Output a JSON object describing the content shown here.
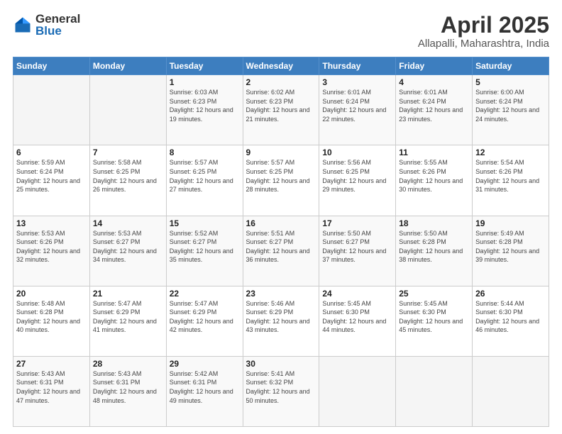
{
  "logo": {
    "general": "General",
    "blue": "Blue"
  },
  "header": {
    "title": "April 2025",
    "subtitle": "Allapalli, Maharashtra, India"
  },
  "weekdays": [
    "Sunday",
    "Monday",
    "Tuesday",
    "Wednesday",
    "Thursday",
    "Friday",
    "Saturday"
  ],
  "weeks": [
    [
      {
        "day": "",
        "sunrise": "",
        "sunset": "",
        "daylight": ""
      },
      {
        "day": "",
        "sunrise": "",
        "sunset": "",
        "daylight": ""
      },
      {
        "day": "1",
        "sunrise": "Sunrise: 6:03 AM",
        "sunset": "Sunset: 6:23 PM",
        "daylight": "Daylight: 12 hours and 19 minutes."
      },
      {
        "day": "2",
        "sunrise": "Sunrise: 6:02 AM",
        "sunset": "Sunset: 6:23 PM",
        "daylight": "Daylight: 12 hours and 21 minutes."
      },
      {
        "day": "3",
        "sunrise": "Sunrise: 6:01 AM",
        "sunset": "Sunset: 6:24 PM",
        "daylight": "Daylight: 12 hours and 22 minutes."
      },
      {
        "day": "4",
        "sunrise": "Sunrise: 6:01 AM",
        "sunset": "Sunset: 6:24 PM",
        "daylight": "Daylight: 12 hours and 23 minutes."
      },
      {
        "day": "5",
        "sunrise": "Sunrise: 6:00 AM",
        "sunset": "Sunset: 6:24 PM",
        "daylight": "Daylight: 12 hours and 24 minutes."
      }
    ],
    [
      {
        "day": "6",
        "sunrise": "Sunrise: 5:59 AM",
        "sunset": "Sunset: 6:24 PM",
        "daylight": "Daylight: 12 hours and 25 minutes."
      },
      {
        "day": "7",
        "sunrise": "Sunrise: 5:58 AM",
        "sunset": "Sunset: 6:25 PM",
        "daylight": "Daylight: 12 hours and 26 minutes."
      },
      {
        "day": "8",
        "sunrise": "Sunrise: 5:57 AM",
        "sunset": "Sunset: 6:25 PM",
        "daylight": "Daylight: 12 hours and 27 minutes."
      },
      {
        "day": "9",
        "sunrise": "Sunrise: 5:57 AM",
        "sunset": "Sunset: 6:25 PM",
        "daylight": "Daylight: 12 hours and 28 minutes."
      },
      {
        "day": "10",
        "sunrise": "Sunrise: 5:56 AM",
        "sunset": "Sunset: 6:25 PM",
        "daylight": "Daylight: 12 hours and 29 minutes."
      },
      {
        "day": "11",
        "sunrise": "Sunrise: 5:55 AM",
        "sunset": "Sunset: 6:26 PM",
        "daylight": "Daylight: 12 hours and 30 minutes."
      },
      {
        "day": "12",
        "sunrise": "Sunrise: 5:54 AM",
        "sunset": "Sunset: 6:26 PM",
        "daylight": "Daylight: 12 hours and 31 minutes."
      }
    ],
    [
      {
        "day": "13",
        "sunrise": "Sunrise: 5:53 AM",
        "sunset": "Sunset: 6:26 PM",
        "daylight": "Daylight: 12 hours and 32 minutes."
      },
      {
        "day": "14",
        "sunrise": "Sunrise: 5:53 AM",
        "sunset": "Sunset: 6:27 PM",
        "daylight": "Daylight: 12 hours and 34 minutes."
      },
      {
        "day": "15",
        "sunrise": "Sunrise: 5:52 AM",
        "sunset": "Sunset: 6:27 PM",
        "daylight": "Daylight: 12 hours and 35 minutes."
      },
      {
        "day": "16",
        "sunrise": "Sunrise: 5:51 AM",
        "sunset": "Sunset: 6:27 PM",
        "daylight": "Daylight: 12 hours and 36 minutes."
      },
      {
        "day": "17",
        "sunrise": "Sunrise: 5:50 AM",
        "sunset": "Sunset: 6:27 PM",
        "daylight": "Daylight: 12 hours and 37 minutes."
      },
      {
        "day": "18",
        "sunrise": "Sunrise: 5:50 AM",
        "sunset": "Sunset: 6:28 PM",
        "daylight": "Daylight: 12 hours and 38 minutes."
      },
      {
        "day": "19",
        "sunrise": "Sunrise: 5:49 AM",
        "sunset": "Sunset: 6:28 PM",
        "daylight": "Daylight: 12 hours and 39 minutes."
      }
    ],
    [
      {
        "day": "20",
        "sunrise": "Sunrise: 5:48 AM",
        "sunset": "Sunset: 6:28 PM",
        "daylight": "Daylight: 12 hours and 40 minutes."
      },
      {
        "day": "21",
        "sunrise": "Sunrise: 5:47 AM",
        "sunset": "Sunset: 6:29 PM",
        "daylight": "Daylight: 12 hours and 41 minutes."
      },
      {
        "day": "22",
        "sunrise": "Sunrise: 5:47 AM",
        "sunset": "Sunset: 6:29 PM",
        "daylight": "Daylight: 12 hours and 42 minutes."
      },
      {
        "day": "23",
        "sunrise": "Sunrise: 5:46 AM",
        "sunset": "Sunset: 6:29 PM",
        "daylight": "Daylight: 12 hours and 43 minutes."
      },
      {
        "day": "24",
        "sunrise": "Sunrise: 5:45 AM",
        "sunset": "Sunset: 6:30 PM",
        "daylight": "Daylight: 12 hours and 44 minutes."
      },
      {
        "day": "25",
        "sunrise": "Sunrise: 5:45 AM",
        "sunset": "Sunset: 6:30 PM",
        "daylight": "Daylight: 12 hours and 45 minutes."
      },
      {
        "day": "26",
        "sunrise": "Sunrise: 5:44 AM",
        "sunset": "Sunset: 6:30 PM",
        "daylight": "Daylight: 12 hours and 46 minutes."
      }
    ],
    [
      {
        "day": "27",
        "sunrise": "Sunrise: 5:43 AM",
        "sunset": "Sunset: 6:31 PM",
        "daylight": "Daylight: 12 hours and 47 minutes."
      },
      {
        "day": "28",
        "sunrise": "Sunrise: 5:43 AM",
        "sunset": "Sunset: 6:31 PM",
        "daylight": "Daylight: 12 hours and 48 minutes."
      },
      {
        "day": "29",
        "sunrise": "Sunrise: 5:42 AM",
        "sunset": "Sunset: 6:31 PM",
        "daylight": "Daylight: 12 hours and 49 minutes."
      },
      {
        "day": "30",
        "sunrise": "Sunrise: 5:41 AM",
        "sunset": "Sunset: 6:32 PM",
        "daylight": "Daylight: 12 hours and 50 minutes."
      },
      {
        "day": "",
        "sunrise": "",
        "sunset": "",
        "daylight": ""
      },
      {
        "day": "",
        "sunrise": "",
        "sunset": "",
        "daylight": ""
      },
      {
        "day": "",
        "sunrise": "",
        "sunset": "",
        "daylight": ""
      }
    ]
  ]
}
